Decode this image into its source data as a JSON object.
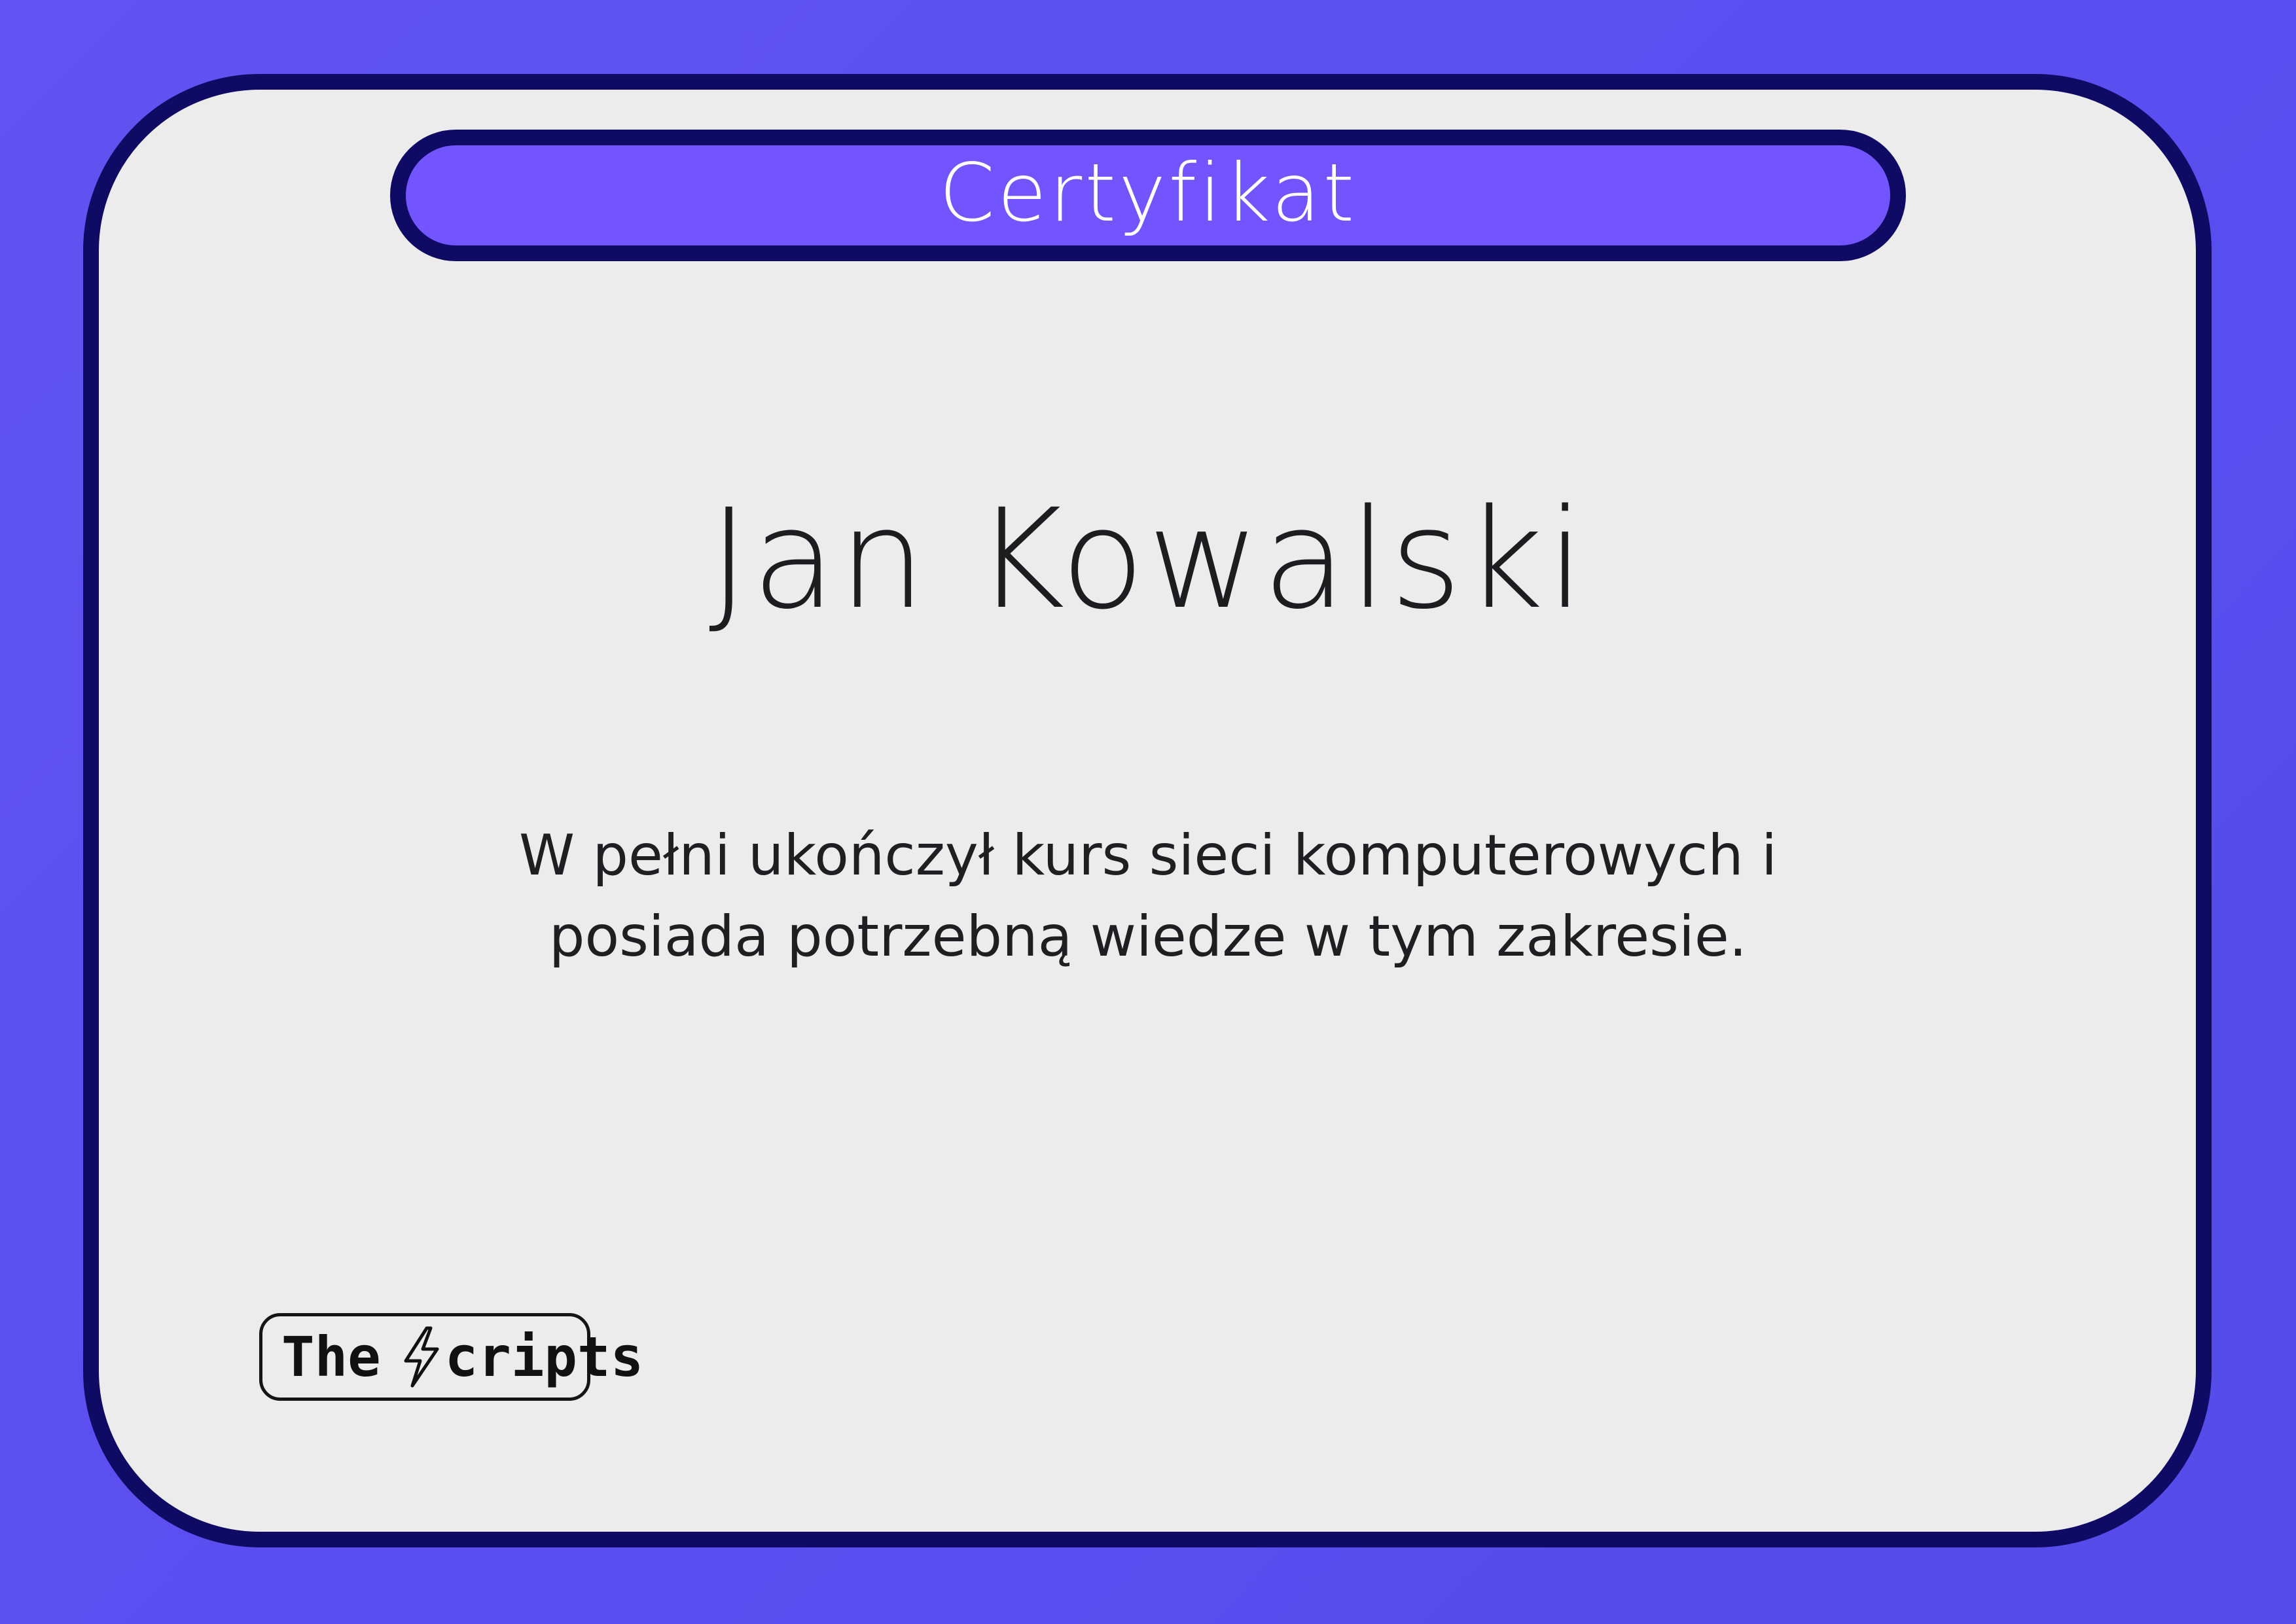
{
  "certificate": {
    "title": "Certyfikat",
    "recipient_name": "Jan Kowalski",
    "description_line1": "W pełni ukończył kurs sieci komputerowych i",
    "description_line2": "posiada potrzebną wiedze w tym zakresie."
  },
  "logo": {
    "text_before_icon": "The",
    "text_after_icon": "cripts",
    "icon": "lightning-bolt-icon"
  },
  "colors": {
    "background": "#5b4fef",
    "border": "#0f0a63",
    "title_bar": "#7355ff",
    "card": "#ececec"
  }
}
